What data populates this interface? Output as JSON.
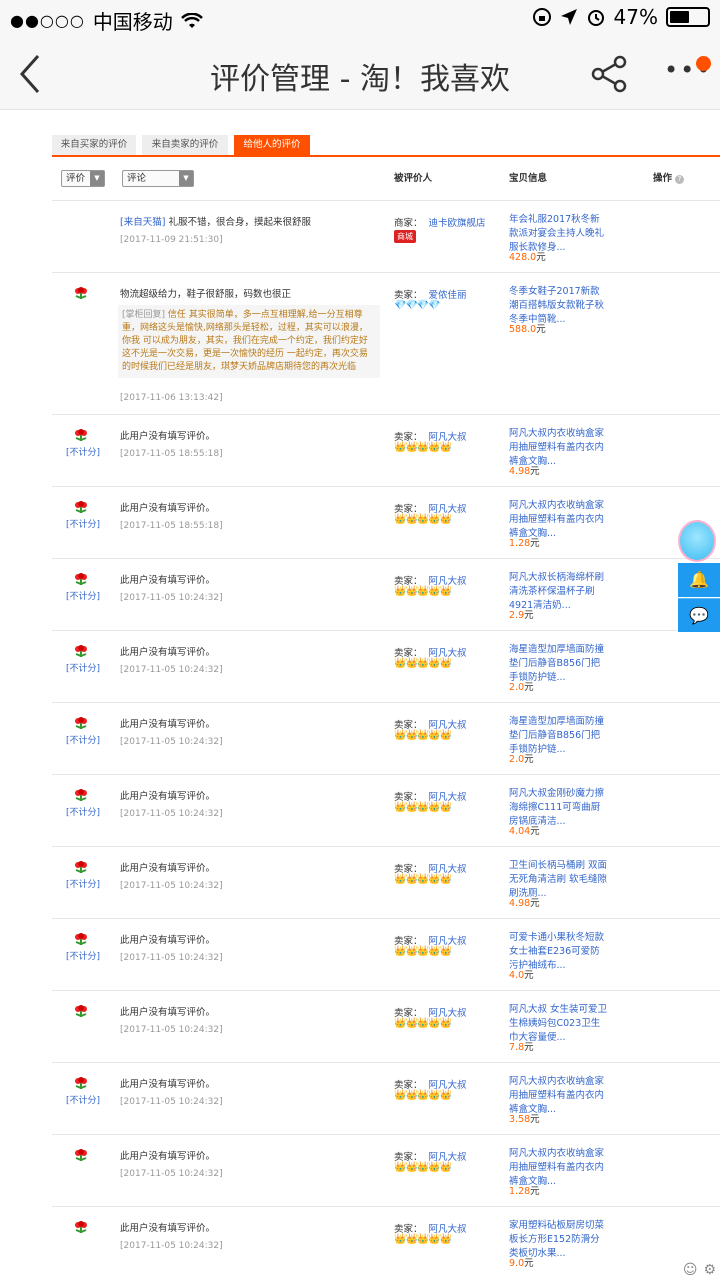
{
  "status": {
    "carrier": "中国移动",
    "battery": "47%"
  },
  "nav": {
    "title": "评价管理 - 淘！我喜欢"
  },
  "tabs": [
    "来自买家的评价",
    "来自卖家的评价",
    "给他人的评价"
  ],
  "filters": {
    "rating": "评价",
    "comment": "评论"
  },
  "columns": {
    "reviewee": "被评价人",
    "item": "宝贝信息",
    "action": "操作"
  },
  "rows": [
    {
      "comment_src": "[来自天猫]",
      "comment": "礼服不错，很合身，摸起来很舒服",
      "time": "[2017-11-09 21:51:30]",
      "role": "商家：",
      "seller": "迪卡欧旗舰店",
      "badge": "商城",
      "item": "年会礼服2017秋冬新款派对宴会主持人晚礼服长款修身...",
      "price": "428.0",
      "unit": "元"
    },
    {
      "comment": "物流超级给力，鞋子很舒服，码数也很正",
      "reply_tag": "[掌柜回复]",
      "reply": "信任 其实很简单，多一点互相理解,给一分互相尊重，网络这头是愉快,网络那头是轻松，过程，其实可以浪漫，你我 可以成为朋友，其实，我们在完成一个约定，我们约定好这不光是一次交易，更是一次愉快的经历 一起约定，再次交易的时候我们已经是朋友，琪梦天娇品牌店期待您的再次光临",
      "time": "[2017-11-06 13:13:42]",
      "role": "卖家：",
      "seller": "爱侬佳丽",
      "rank": "💎💎💎💎",
      "item": "冬季女鞋子2017新款潮百搭韩版女款靴子秋冬季中筒靴...",
      "price": "588.0",
      "unit": "元"
    },
    {
      "noscore": "[不计分]",
      "comment": "此用户没有填写评价。",
      "time": "[2017-11-05 18:55:18]",
      "role": "卖家：",
      "seller": "阿凡大叔",
      "rank": "👑👑👑👑👑",
      "item": "阿凡大叔内衣收纳盒家用抽屉塑料有盖内衣内裤盒文胸...",
      "price": "4.98",
      "unit": "元"
    },
    {
      "noscore": "[不计分]",
      "comment": "此用户没有填写评价。",
      "time": "[2017-11-05 18:55:18]",
      "role": "卖家：",
      "seller": "阿凡大叔",
      "rank": "👑👑👑👑👑",
      "item": "阿凡大叔内衣收纳盒家用抽屉塑料有盖内衣内裤盒文胸...",
      "price": "1.28",
      "unit": "元"
    },
    {
      "noscore": "[不计分]",
      "comment": "此用户没有填写评价。",
      "time": "[2017-11-05 10:24:32]",
      "role": "卖家：",
      "seller": "阿凡大叔",
      "rank": "👑👑👑👑👑",
      "item": "阿凡大叔长柄海绵杯刷清洗茶杯保温杯子刷4921清洁奶...",
      "price": "2.9",
      "unit": "元"
    },
    {
      "noscore": "[不计分]",
      "comment": "此用户没有填写评价。",
      "time": "[2017-11-05 10:24:32]",
      "role": "卖家：",
      "seller": "阿凡大叔",
      "rank": "👑👑👑👑👑",
      "item": "海星造型加厚墙面防撞垫门后静音B856门把手锁防护链...",
      "price": "2.0",
      "unit": "元"
    },
    {
      "noscore": "[不计分]",
      "comment": "此用户没有填写评价。",
      "time": "[2017-11-05 10:24:32]",
      "role": "卖家：",
      "seller": "阿凡大叔",
      "rank": "👑👑👑👑👑",
      "item": "海星造型加厚墙面防撞垫门后静音B856门把手锁防护链...",
      "price": "2.0",
      "unit": "元"
    },
    {
      "noscore": "[不计分]",
      "comment": "此用户没有填写评价。",
      "time": "[2017-11-05 10:24:32]",
      "role": "卖家：",
      "seller": "阿凡大叔",
      "rank": "👑👑👑👑👑",
      "item": "阿凡大叔金刚砂魔力擦海绵擦C111可弯曲厨房锅底清洁...",
      "price": "4.04",
      "unit": "元"
    },
    {
      "noscore": "[不计分]",
      "comment": "此用户没有填写评价。",
      "time": "[2017-11-05 10:24:32]",
      "role": "卖家：",
      "seller": "阿凡大叔",
      "rank": "👑👑👑👑👑",
      "item": "卫生间长柄马桶刷 双面无死角清洁刷 软毛缝隙刷洗厕...",
      "price": "4.98",
      "unit": "元"
    },
    {
      "noscore": "[不计分]",
      "comment": "此用户没有填写评价。",
      "time": "[2017-11-05 10:24:32]",
      "role": "卖家：",
      "seller": "阿凡大叔",
      "rank": "👑👑👑👑👑",
      "item": "可爱卡通小果秋冬短款女士袖套E236可爱防污护袖绒布...",
      "price": "4.0",
      "unit": "元"
    },
    {
      "comment": "此用户没有填写评价。",
      "time": "[2017-11-05 10:24:32]",
      "role": "卖家：",
      "seller": "阿凡大叔",
      "rank": "👑👑👑👑👑",
      "item": "阿凡大叔 女生装可爱卫生棉姨妈包C023卫生巾大容量便...",
      "price": "7.8",
      "unit": "元"
    },
    {
      "noscore": "[不计分]",
      "comment": "此用户没有填写评价。",
      "time": "[2017-11-05 10:24:32]",
      "role": "卖家：",
      "seller": "阿凡大叔",
      "rank": "👑👑👑👑👑",
      "item": "阿凡大叔内衣收纳盒家用抽屉塑料有盖内衣内裤盒文胸...",
      "price": "3.58",
      "unit": "元"
    },
    {
      "comment": "此用户没有填写评价。",
      "time": "[2017-11-05 10:24:32]",
      "role": "卖家：",
      "seller": "阿凡大叔",
      "rank": "👑👑👑👑👑",
      "item": "阿凡大叔内衣收纳盒家用抽屉塑料有盖内衣内裤盒文胸...",
      "price": "1.28",
      "unit": "元"
    },
    {
      "comment": "此用户没有填写评价。",
      "time": "[2017-11-05 10:24:32]",
      "role": "卖家：",
      "seller": "阿凡大叔",
      "rank": "👑👑👑👑👑",
      "item": "家用塑料砧板厨房切菜板长方形E152防滑分类板切水果...",
      "price": "9.0",
      "unit": "元"
    }
  ],
  "colors": {
    "accent": "#ff5000",
    "link": "#3366cc",
    "float_button": "#1e9bf0"
  },
  "icons": [
    "back-arrow-icon",
    "share-icon",
    "more-icon",
    "flower-icon",
    "bell-icon",
    "chat-icon"
  ]
}
